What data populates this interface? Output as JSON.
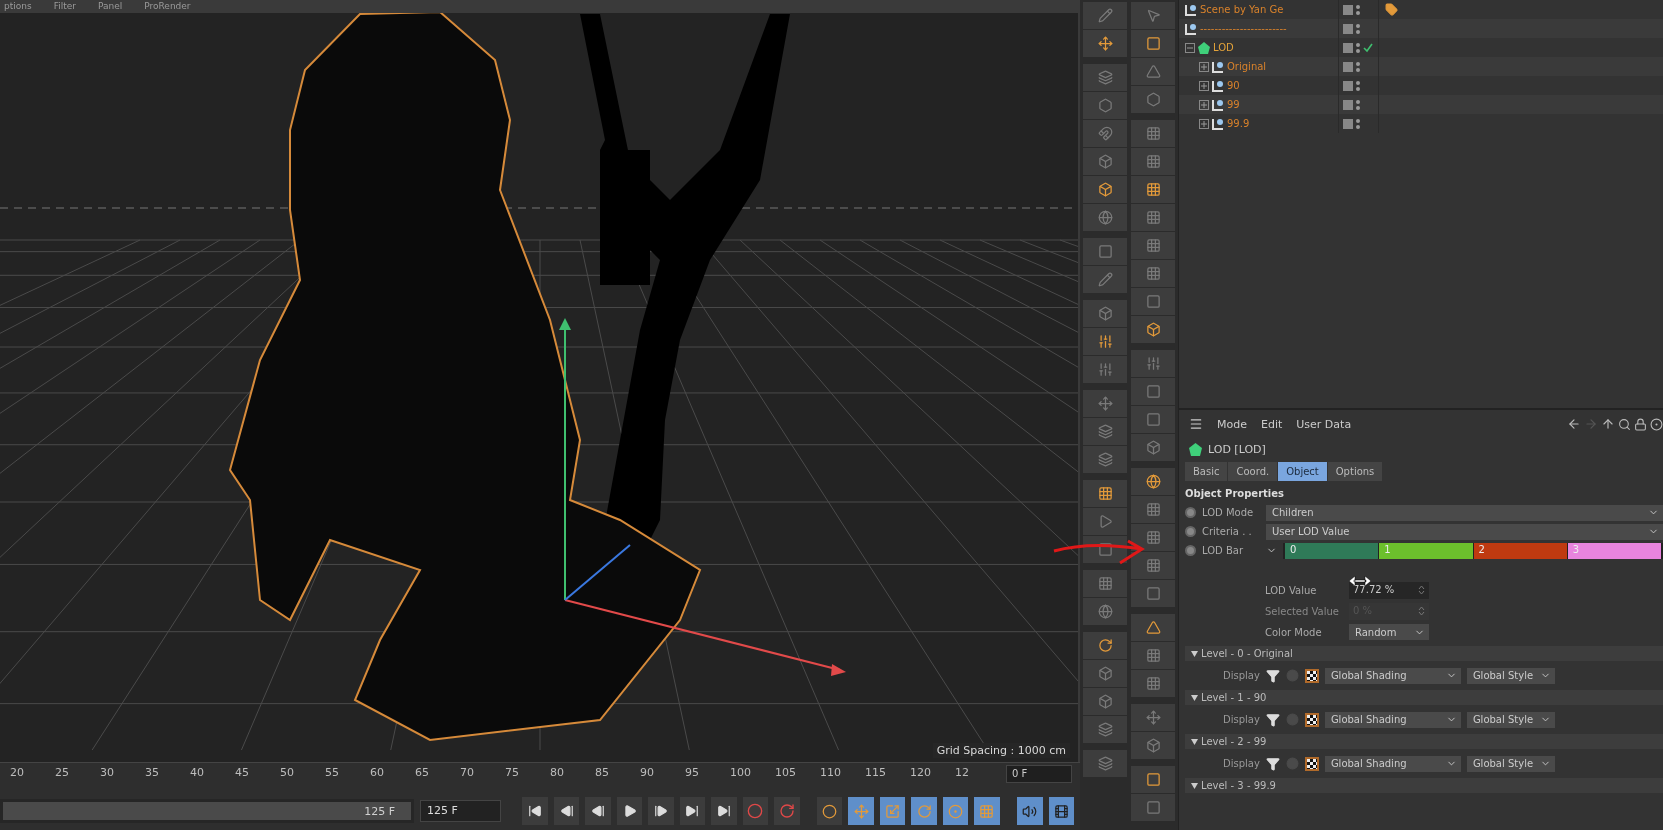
{
  "viewport": {
    "menu": [
      "ptions",
      "Filter",
      "Panel",
      "ProRender"
    ],
    "grid_spacing": "Grid Spacing : 1000 cm"
  },
  "timeline": {
    "ticks": [
      "20",
      "25",
      "30",
      "35",
      "40",
      "45",
      "50",
      "55",
      "60",
      "65",
      "70",
      "75",
      "80",
      "85",
      "90",
      "95",
      "100",
      "105",
      "110",
      "115",
      "120",
      "12"
    ],
    "current_frame": "0 F"
  },
  "playback": {
    "end_label": "125 F",
    "end_field": "125 F",
    "level": 1,
    "mode_buttons": [
      {
        "selected": false
      },
      {
        "selected": true
      },
      {
        "selected": true
      },
      {
        "selected": true
      },
      {
        "selected": true
      },
      {
        "selected": true
      }
    ],
    "view_buttons": [
      {
        "selected": true
      },
      {
        "selected": true
      }
    ]
  },
  "object_manager": {
    "rows": [
      {
        "name": "Scene by Yan Ge",
        "kind": "null",
        "checked": false,
        "tag": true
      },
      {
        "name": "------------------------",
        "kind": "null",
        "checked": false,
        "tag": false
      },
      {
        "name": "LOD",
        "kind": "lod",
        "checked": true,
        "tag": false,
        "expanded": true,
        "children": [
          {
            "name": "Original",
            "kind": "null",
            "checked": false,
            "tag": false,
            "expanded": false
          },
          {
            "name": "90",
            "kind": "null",
            "checked": false,
            "tag": false,
            "expanded": false
          },
          {
            "name": "99",
            "kind": "null",
            "checked": false,
            "tag": false,
            "expanded": false
          },
          {
            "name": "99.9",
            "kind": "null",
            "checked": false,
            "tag": false,
            "expanded": false
          }
        ]
      }
    ]
  },
  "attributes": {
    "menu": [
      "Mode",
      "Edit",
      "User Data"
    ],
    "title": "LOD [LOD]",
    "tabs": [
      {
        "label": "Basic",
        "selected": false
      },
      {
        "label": "Coord.",
        "selected": false
      },
      {
        "label": "Object",
        "selected": true
      },
      {
        "label": "Options",
        "selected": false
      }
    ],
    "section": "Object Properties",
    "fields": [
      {
        "label": "LOD Mode",
        "kind": "dropdown",
        "value": "Children",
        "animated": false
      },
      {
        "label": "Criteria . .",
        "kind": "dropdown",
        "value": "User LOD Value",
        "animated": false
      },
      {
        "label": "LOD Bar",
        "kind": "lodbar",
        "animated": false,
        "segments": [
          {
            "label": "0",
            "color": "#2f7a58"
          },
          {
            "label": "1",
            "color": "#6cc02c"
          },
          {
            "label": "2",
            "color": "#bf3a10"
          },
          {
            "label": "3",
            "color": "#e884de"
          }
        ]
      }
    ],
    "sub_fields": [
      {
        "label": "LOD Value",
        "kind": "number",
        "value": "77.72 %",
        "disabled": false
      },
      {
        "label": "Selected Value",
        "kind": "number",
        "value": "0 %",
        "disabled": true
      },
      {
        "label": "Color Mode",
        "kind": "dropdown",
        "value": "Random",
        "disabled": false
      }
    ],
    "levels": [
      {
        "title": "Level - 0 - Original",
        "expanded": true,
        "display": "Display",
        "shading": "Global Shading",
        "style": "Global Style"
      },
      {
        "title": "Level - 1 - 90",
        "expanded": true,
        "display": "Display",
        "shading": "Global Shading",
        "style": "Global Style"
      },
      {
        "title": "Level - 2 - 99",
        "expanded": true,
        "display": "Display",
        "shading": "Global Shading",
        "style": "Global Style"
      },
      {
        "title": "Level - 3 - 99.9",
        "expanded": true
      }
    ]
  }
}
